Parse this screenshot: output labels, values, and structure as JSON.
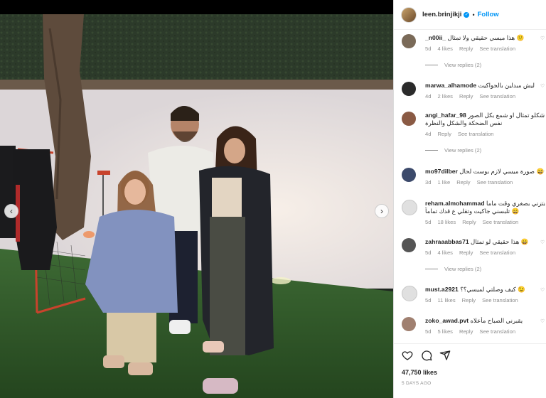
{
  "post": {
    "username": "leen.brinjikji",
    "separator": "•",
    "follow_label": "Follow",
    "likes": "47,750 likes",
    "date": "5 DAYS AGO"
  },
  "comments": [
    {
      "user": "_n00ii_",
      "text": "هذا ميسي حقيقي ولا تمثال 🙂",
      "age": "5d",
      "likes": "4 likes",
      "reply": "Reply",
      "translate": "See translation",
      "replies": "View replies (2)",
      "avatar_color": "#7a6a58"
    },
    {
      "user": "marwa_alhamode",
      "text": "ليش مبدلين بالجواكيت",
      "age": "4d",
      "likes": "2 likes",
      "reply": "Reply",
      "translate": "See translation",
      "replies": "",
      "avatar_color": "#2b2b2b"
    },
    {
      "user": "angi_hafar_98",
      "text": "شكلو تمثال او شمع بكل الصور",
      "text2": "نفس الضحكة والشكل والنظرة",
      "age": "4d",
      "likes": "",
      "reply": "Reply",
      "translate": "See translation",
      "replies": "View replies (2)",
      "avatar_color": "#8a5a44"
    },
    {
      "user": "mo97dilber",
      "text": "صورة ميسي لازم بوست لحال 😄",
      "age": "3d",
      "likes": "1 like",
      "reply": "Reply",
      "translate": "See translation",
      "replies": "",
      "avatar_color": "#3c4a6b"
    },
    {
      "user": "reham.almohammad",
      "text": "بنرني بصغري وقت ماما",
      "text2": "تلبسني جاكيت وتقلي ع قدك تماماً 😄",
      "age": "5d",
      "likes": "18 likes",
      "reply": "Reply",
      "translate": "See translation",
      "replies": "",
      "avatar_color": "#e0e0e0"
    },
    {
      "user": "zahraaabbas71",
      "text": "هذا حقيقي لو تمثال 😄",
      "age": "5d",
      "likes": "4 likes",
      "reply": "Reply",
      "translate": "See translation",
      "replies": "View replies (2)",
      "avatar_color": "#555555"
    },
    {
      "user": "must.a2921",
      "text": "كيف وصلتي لميسي؟؟ 😉",
      "age": "5d",
      "likes": "11 likes",
      "reply": "Reply",
      "translate": "See translation",
      "replies": "",
      "avatar_color": "#e0e0e0"
    },
    {
      "user": "zoko_awad.pvt",
      "text": "يقبرني الصباح مأعلاه",
      "age": "5d",
      "likes": "5 likes",
      "reply": "Reply",
      "translate": "See translation",
      "replies": "",
      "avatar_color": "#a08070"
    }
  ],
  "icons": {
    "like": "heart-icon",
    "comment": "comment-icon",
    "share": "share-icon",
    "prev": "chevron-left-icon",
    "next": "chevron-right-icon",
    "nav_prev_glyph": "‹",
    "nav_next_glyph": "›"
  },
  "colors": {
    "accent": "#0095f6",
    "muted": "#8e8e8e",
    "text": "#262626"
  }
}
